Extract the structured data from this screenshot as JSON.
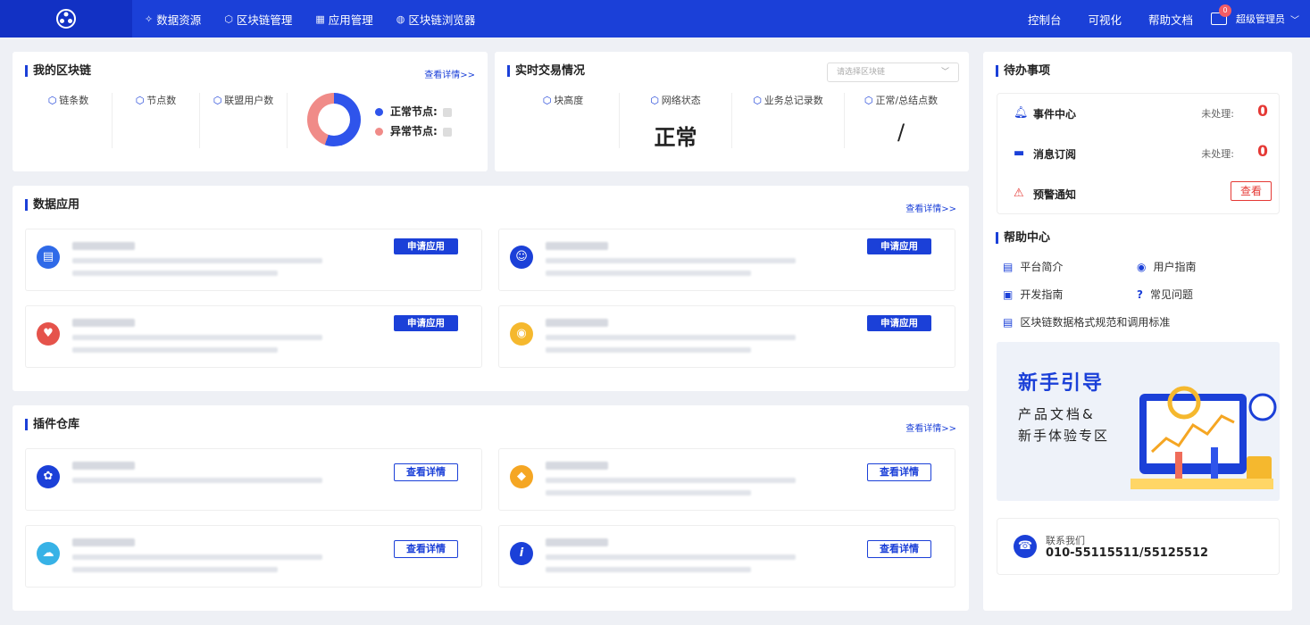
{
  "nav": {
    "items": [
      {
        "icon": "cube-icon",
        "label": "数据资源"
      },
      {
        "icon": "hexagon-icon",
        "label": "区块链管理"
      },
      {
        "icon": "grid-icon",
        "label": "应用管理"
      },
      {
        "icon": "globe-icon",
        "label": "区块链浏览器"
      }
    ],
    "right": [
      "控制台",
      "可视化",
      "帮助文档"
    ],
    "mail_badge": "0",
    "user": "超级管理员"
  },
  "my_chain": {
    "title": "我的区块链",
    "link": "查看详情>>",
    "stats": [
      "链条数",
      "节点数",
      "联盟用户数"
    ],
    "legend": [
      {
        "label": "正常节点:",
        "color": "#2f54eb"
      },
      {
        "label": "异常节点:",
        "color": "#f08b88"
      }
    ]
  },
  "realtime": {
    "title": "实时交易情况",
    "select_placeholder": "请选择区块链",
    "stats": [
      {
        "label": "块高度",
        "value": ""
      },
      {
        "label": "网络状态",
        "value": "正常"
      },
      {
        "label": "业务总记录数",
        "value": ""
      },
      {
        "label": "正常/总结点数",
        "value": "/"
      }
    ]
  },
  "data_apps": {
    "title": "数据应用",
    "link": "查看详情>>",
    "button": "申请应用",
    "tiles": [
      {
        "icon": "building-icon",
        "color": "#2f6ae8"
      },
      {
        "icon": "support-icon",
        "color": "#1b40d8"
      },
      {
        "icon": "heart-icon",
        "color": "#e5534b"
      },
      {
        "icon": "coin-icon",
        "color": "#f5b82e"
      }
    ]
  },
  "plugins": {
    "title": "插件仓库",
    "link": "查看详情>>",
    "button": "查看详情",
    "tiles": [
      {
        "icon": "puzzle-icon",
        "color": "#1b40d8"
      },
      {
        "icon": "orange-plugin-icon",
        "color": "#f5a623"
      },
      {
        "icon": "cloud-icon",
        "color": "#37b2e6"
      },
      {
        "icon": "info-icon",
        "color": "#1b40d8"
      }
    ]
  },
  "todo": {
    "title": "待办事项",
    "rows": [
      {
        "icon": "bell-icon",
        "label": "事件中心",
        "status": "未处理:",
        "value": "0"
      },
      {
        "icon": "message-icon",
        "label": "消息订阅",
        "status": "未处理:",
        "value": "0"
      },
      {
        "icon": "alarm-icon",
        "label": "预警通知",
        "button": "查看"
      }
    ]
  },
  "help": {
    "title": "帮助中心",
    "links": [
      {
        "icon": "doc-icon",
        "label": "平台简介"
      },
      {
        "icon": "compass-icon",
        "label": "用户指南"
      },
      {
        "icon": "code-icon",
        "label": "开发指南"
      },
      {
        "icon": "question-icon",
        "label": "常见问题"
      },
      {
        "icon": "doc-icon",
        "label": "区块链数据格式规范和调用标准"
      }
    ]
  },
  "guide": {
    "title": "新手引导",
    "line1": "产品文档&",
    "line2": "新手体验专区"
  },
  "contact": {
    "label": "联系我们",
    "phone": "010-55115511/55125512"
  }
}
